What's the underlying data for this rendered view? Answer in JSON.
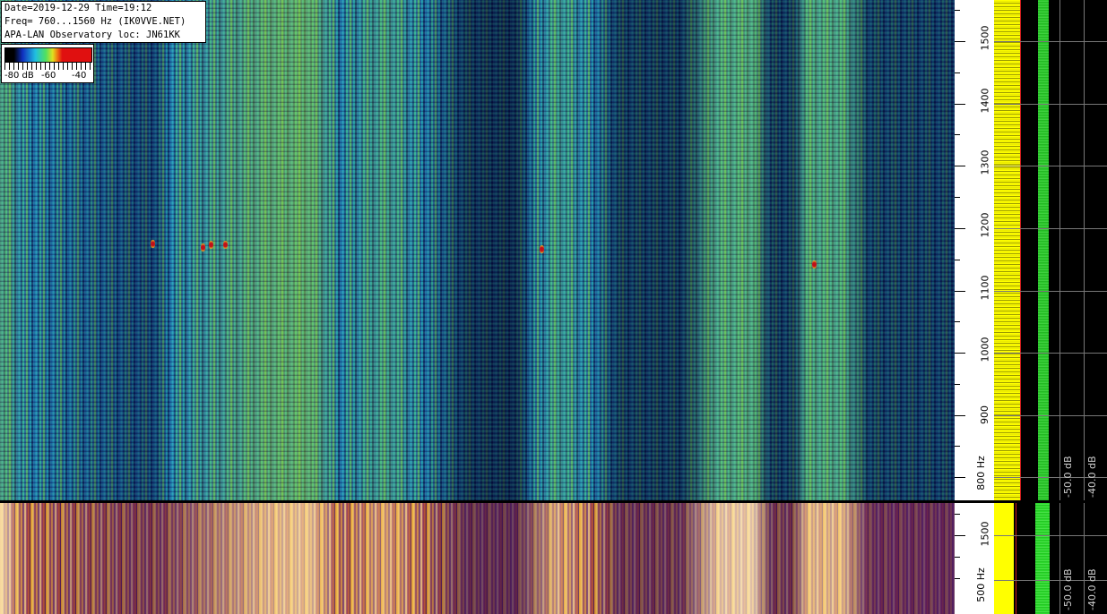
{
  "info": {
    "line1": "Date=2019-12-29 Time=19:12",
    "line2": "Freq= 760...1560 Hz (IK0VVE.NET)",
    "line3": "APA-LAN Observatory loc: JN61KK"
  },
  "scale": {
    "min_label": "-80 dB",
    "mid_label": "-60",
    "max_label": "-40"
  },
  "freq_axis": {
    "labels": [
      "1500",
      "1400",
      "1300",
      "1200",
      "1100",
      "1000",
      "900",
      "800 Hz"
    ],
    "lower_labels": [
      "1500",
      "500 Hz"
    ]
  },
  "spectrum": {
    "db_label_a": "-50.0 dB",
    "db_label_b": "-40.0 dB",
    "lower_db_a": "-50.0 dB",
    "lower_db_b": "-40.0 dB"
  },
  "colors": {
    "waterfall_palette": [
      "#000000",
      "#1030c0",
      "#20c0e0",
      "#50e060",
      "#e0e020",
      "#e01010"
    ],
    "spectrum_trace": "#ffff00",
    "peak_trace": "#30d030",
    "time_label": "#d01818"
  }
}
